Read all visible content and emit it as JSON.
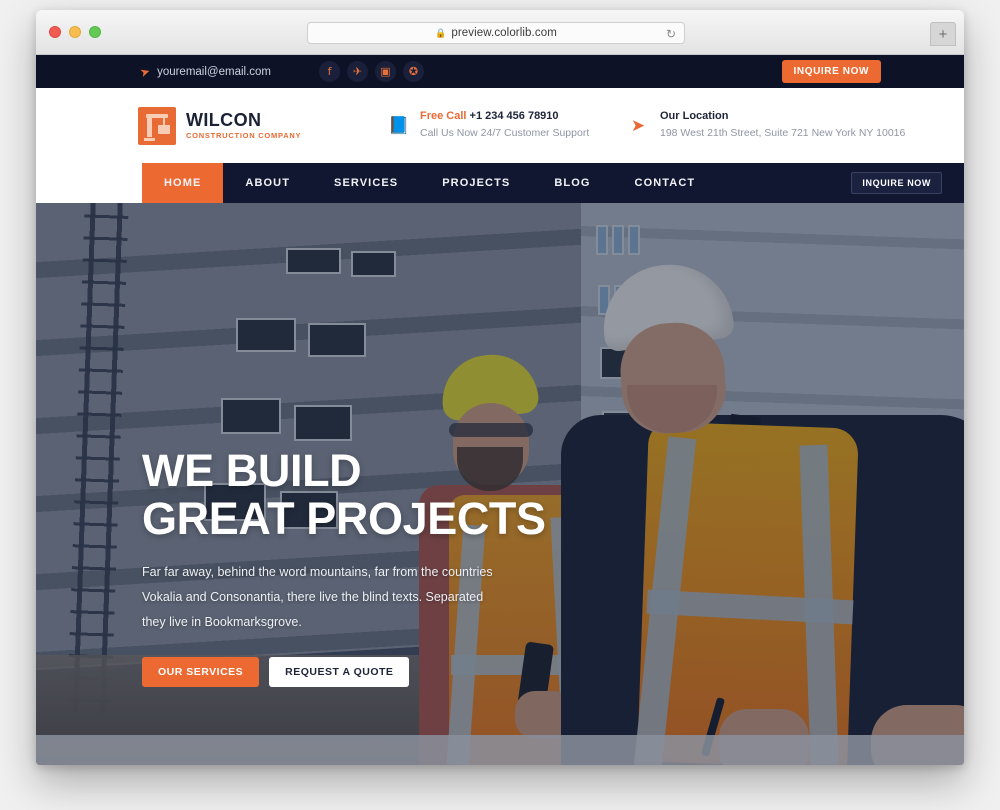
{
  "browser": {
    "url": "preview.colorlib.com",
    "lock_icon": "lock-icon",
    "reload_icon": "reload-icon",
    "newtab_icon": "plus-icon",
    "traffic_lights": [
      "close",
      "minimize",
      "maximize"
    ]
  },
  "topbar": {
    "email": "youremail@email.com",
    "email_icon": "paper-plane-icon",
    "social": [
      {
        "name": "facebook-icon",
        "glyph": "f"
      },
      {
        "name": "twitter-icon",
        "glyph": "✈"
      },
      {
        "name": "instagram-icon",
        "glyph": "▣"
      },
      {
        "name": "dribbble-icon",
        "glyph": "✪"
      }
    ],
    "cta_label": "INQUIRE NOW"
  },
  "header": {
    "logo": {
      "name": "WILCON",
      "tagline": "CONSTRUCTION COMPANY",
      "icon": "crane-icon"
    },
    "info": [
      {
        "icon": "phone-book-icon",
        "label": "Free Call",
        "value": "+1 234 456 78910",
        "sub": "Call Us Now 24/7 Customer Support"
      },
      {
        "icon": "paper-plane-icon",
        "label": "Our Location",
        "value": "",
        "sub": "198 West 21th Street, Suite 721 New York NY 10016"
      }
    ]
  },
  "nav": {
    "items": [
      {
        "label": "HOME",
        "active": true
      },
      {
        "label": "ABOUT",
        "active": false
      },
      {
        "label": "SERVICES",
        "active": false
      },
      {
        "label": "PROJECTS",
        "active": false
      },
      {
        "label": "BLOG",
        "active": false
      },
      {
        "label": "CONTACT",
        "active": false
      }
    ],
    "cta_label": "INQUIRE NOW"
  },
  "hero": {
    "title_line1": "WE BUILD",
    "title_line2": "GREAT PROJECTS",
    "description": "Far far away, behind the word mountains, far from the countries Vokalia and Consonantia, there live the blind texts. Separated they live in Bookmarksgrove.",
    "primary_button": "OUR SERVICES",
    "secondary_button": "REQUEST A QUOTE"
  },
  "colors": {
    "accent_orange": "#ec6a32",
    "dark_navy": "#111730",
    "topbar_navy": "#0d1227",
    "text_light": "#ffffff"
  }
}
